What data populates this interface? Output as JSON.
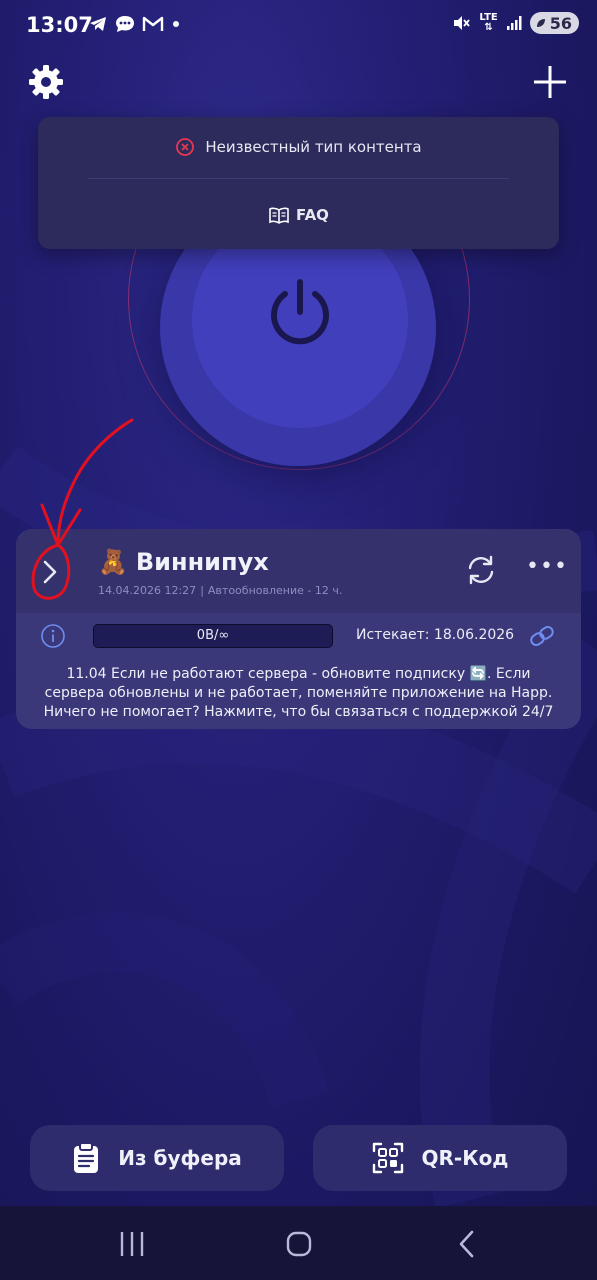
{
  "status_bar": {
    "time": "13:07",
    "left_icons": [
      "telegram-icon",
      "chat-bubble-icon",
      "gmail-icon",
      "dot-icon"
    ],
    "right_icons": [
      "mute-icon",
      "lte-icon",
      "signal-icon",
      "battery-icon"
    ],
    "network": "LTE",
    "battery": "56"
  },
  "top_bar": {
    "settings_icon": "gear-icon",
    "add_icon": "plus-icon"
  },
  "popup": {
    "error_icon": "error-x-icon",
    "error_text": "Неизвестный тип контента",
    "faq_icon": "book-icon",
    "faq_label": "FAQ"
  },
  "power_button": {
    "icon": "power-icon"
  },
  "subscription": {
    "emoji": "🧸",
    "name": "Виннипух",
    "date": "14.04.2026 12:27",
    "separator": "|",
    "auto_update": "Автообновление - 12 ч.",
    "traffic": "0B/∞",
    "expires": "Истекает: 18.06.2026",
    "message": "11.04 Если не работают сервера - обновите подписку 🔄. Если сервера обновлены и не работает, поменяйте приложение на Happ. Ничего не помогает? Нажмите, что бы связаться с поддержкой 24/7",
    "menu_label": "•••"
  },
  "actions": {
    "clipboard_label": "Из буфера",
    "qr_label": "QR-Код"
  },
  "nav": {
    "recent_icon": "recent-apps-icon",
    "home_icon": "home-icon",
    "back_icon": "back-icon"
  },
  "colors": {
    "background": "#231f74",
    "card": "#3a3878",
    "accent": "#423fbd",
    "error": "#e53950",
    "annotation": "#e3101f"
  }
}
